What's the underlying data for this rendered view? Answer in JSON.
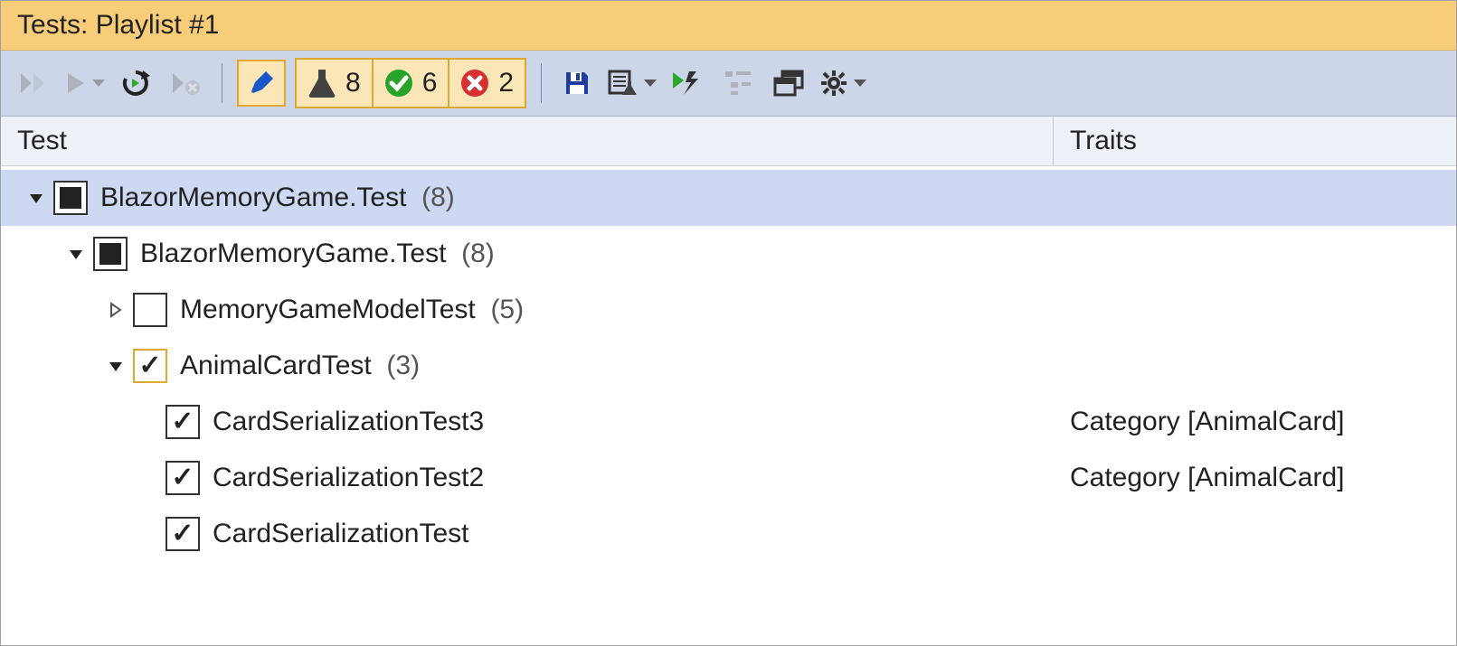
{
  "title": "Tests: Playlist #1",
  "toolbar": {
    "counts": {
      "total": "8",
      "passed": "6",
      "failed": "2"
    }
  },
  "columns": {
    "test": "Test",
    "traits": "Traits"
  },
  "tree": {
    "root": {
      "label": "BlazorMemoryGame.Test",
      "count": "(8)",
      "child": {
        "label": "BlazorMemoryGame.Test",
        "count": "(8)",
        "groups": [
          {
            "label": "MemoryGameModelTest",
            "count": "(5)"
          },
          {
            "label": "AnimalCardTest",
            "count": "(3)",
            "tests": [
              {
                "label": "CardSerializationTest3",
                "traits": "Category [AnimalCard]"
              },
              {
                "label": "CardSerializationTest2",
                "traits": "Category [AnimalCard]"
              },
              {
                "label": "CardSerializationTest",
                "traits": ""
              }
            ]
          }
        ]
      }
    }
  }
}
